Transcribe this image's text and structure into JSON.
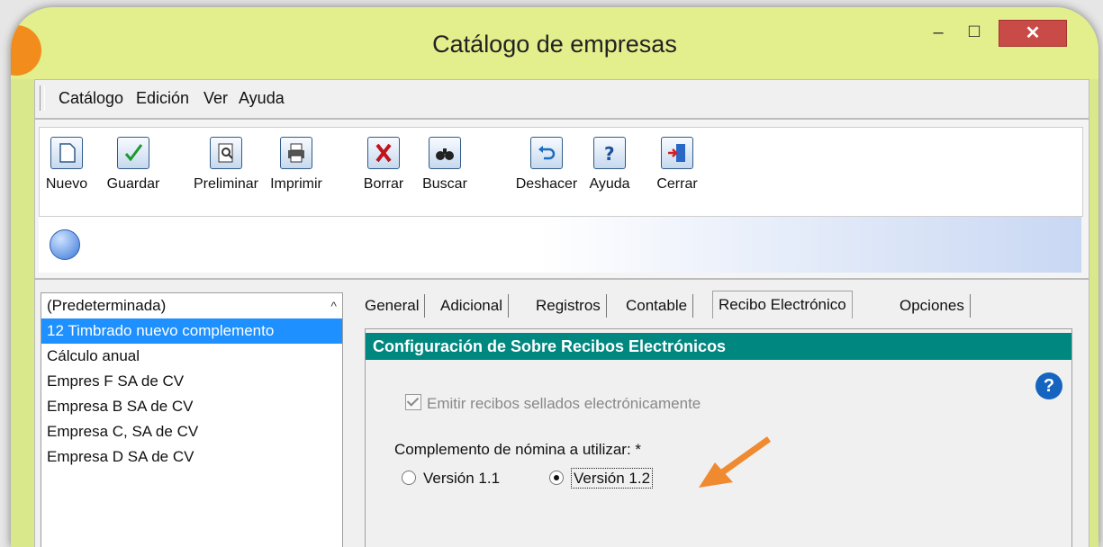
{
  "window": {
    "title": "Catálogo de empresas",
    "min_glyph": "–",
    "max_glyph": "☐",
    "close_glyph": "✕"
  },
  "menu": [
    {
      "label": "Catálogo"
    },
    {
      "label": "Edición"
    },
    {
      "label": "Ver"
    },
    {
      "label": "Ayuda"
    }
  ],
  "toolbar": [
    {
      "label": "Nuevo",
      "icon": "new-icon"
    },
    {
      "label": "Guardar",
      "icon": "save-check-icon"
    },
    {
      "label": "Preliminar",
      "icon": "preview-icon"
    },
    {
      "label": "Imprimir",
      "icon": "print-icon"
    },
    {
      "label": "Borrar",
      "icon": "delete-x-icon"
    },
    {
      "label": "Buscar",
      "icon": "binoculars-icon"
    },
    {
      "label": "Deshacer",
      "icon": "undo-icon"
    },
    {
      "label": "Ayuda",
      "icon": "help-question-icon"
    },
    {
      "label": "Cerrar",
      "icon": "exit-door-icon"
    }
  ],
  "companies": {
    "items": [
      "(Predeterminada)",
      "12 Timbrado nuevo complemento",
      "Cálculo anual",
      "Empres F SA de CV",
      "Empresa B SA de CV",
      "Empresa C, SA de CV",
      "Empresa D SA de CV"
    ],
    "selected_index": 1
  },
  "tabs": [
    {
      "label": "General"
    },
    {
      "label": "Adicional"
    },
    {
      "label": "Registros"
    },
    {
      "label": "Contable"
    },
    {
      "label": "Recibo Electrónico",
      "active": true
    },
    {
      "label": "Opciones"
    }
  ],
  "panel": {
    "section_title": "Configuración de Sobre Recibos Electrónicos",
    "checkbox_label": "Emitir recibos sellados electrónicamente",
    "checkbox_checked": true,
    "checkbox_enabled": false,
    "complement_label": "Complemento de nómina a utilizar: *",
    "radio_options": [
      {
        "label": "Versión 1.1",
        "selected": false
      },
      {
        "label": "Versión 1.2",
        "selected": true
      }
    ],
    "help_glyph": "?"
  },
  "colors": {
    "frame": "#d9e88a",
    "section_bar": "#00877f",
    "selection": "#1e90ff",
    "close_button": "#c94b47",
    "annotation_arrow": "#f08a30"
  }
}
